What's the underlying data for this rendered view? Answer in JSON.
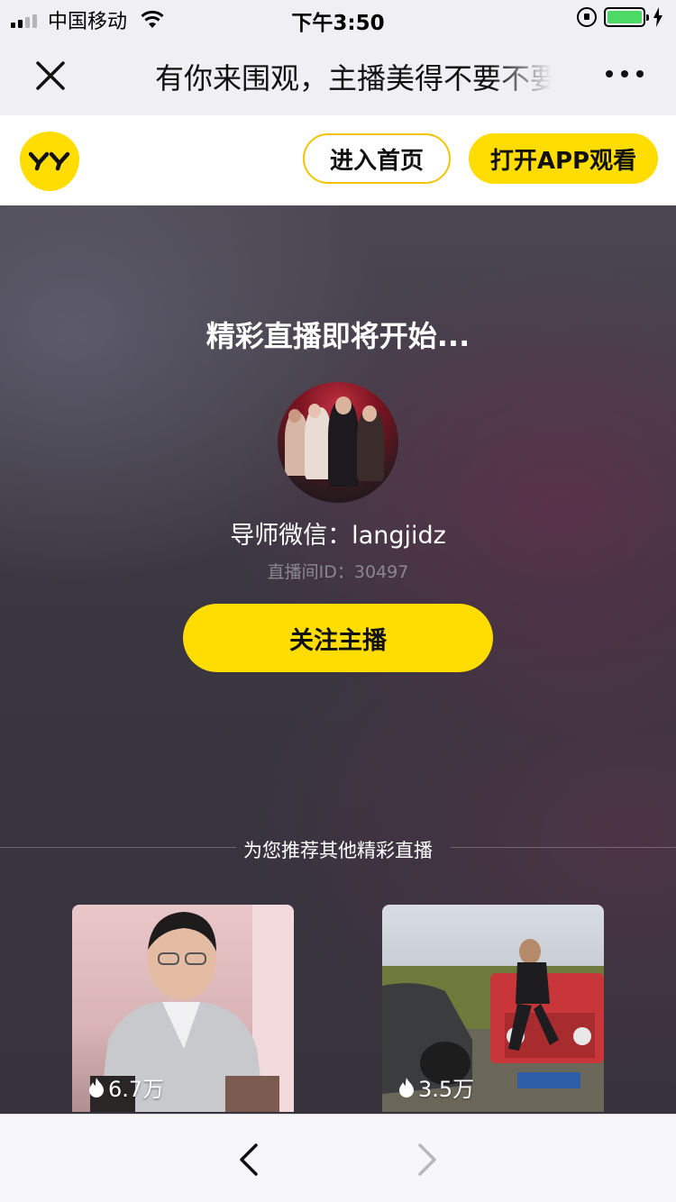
{
  "status_bar": {
    "carrier": "中国移动",
    "time": "下午3:50",
    "battery_level": 1.0,
    "signal_bars": 2
  },
  "nav": {
    "title": "有你来围观，主播美得不要不要的"
  },
  "app_header": {
    "logo_text": "YY",
    "home_button": "进入首页",
    "open_app_button": "打开APP观看"
  },
  "live": {
    "status_text": "精彩直播即将开始...",
    "anchor_name": "导师微信：langjidz",
    "room_id": "直播间ID：30497",
    "follow_button": "关注主播"
  },
  "recommend": {
    "title": "为您推荐其他精彩直播",
    "cards": [
      {
        "heat": "6.7万"
      },
      {
        "heat": "3.5万"
      }
    ]
  },
  "colors": {
    "brand_yellow": "#ffdd00",
    "battery_green": "#4cd964"
  }
}
